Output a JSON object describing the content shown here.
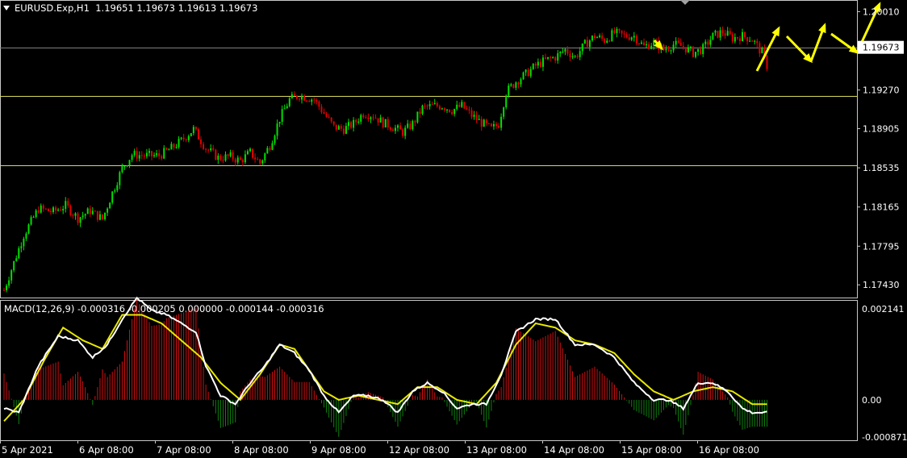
{
  "chart_data": [
    {
      "type": "candlestick",
      "symbol": "EURUSD.Exp,H1",
      "ohlc_header": "1.19651 1.19673 1.19613 1.19673",
      "current_price_label": "1.19673",
      "current_price": 1.19673,
      "ylim": [
        1.1731,
        1.2012
      ],
      "y_ticks": [
        "1.20010",
        "1.19270",
        "1.18905",
        "1.18535",
        "1.18165",
        "1.17795",
        "1.17430"
      ],
      "y_tick_values": [
        1.2001,
        1.1927,
        1.18905,
        1.18535,
        1.18165,
        1.17795,
        1.1743
      ],
      "horizontal_levels": [
        1.19673,
        1.1921,
        1.1856
      ],
      "x_labels": [
        "5 Apr 2021",
        "6 Apr 08:00",
        "7 Apr 08:00",
        "8 Apr 08:00",
        "9 Apr 08:00",
        "12 Apr 08:00",
        "13 Apr 08:00",
        "14 Apr 08:00",
        "15 Apr 08:00",
        "16 Apr 08:00"
      ],
      "bull_color": "#00e000",
      "bear_color": "#e00000",
      "level_color_current": "#808080",
      "level_color_sr": "#d8d860",
      "arrow_color": "#ffff00",
      "close_path": [
        [
          0,
          1.1738
        ],
        [
          8,
          1.179
        ],
        [
          14,
          1.1815
        ],
        [
          20,
          1.1812
        ],
        [
          25,
          1.1818
        ],
        [
          30,
          1.1806
        ],
        [
          35,
          1.1813
        ],
        [
          40,
          1.1805
        ],
        [
          44,
          1.183
        ],
        [
          48,
          1.1853
        ],
        [
          52,
          1.1866
        ],
        [
          58,
          1.1865
        ],
        [
          63,
          1.1865
        ],
        [
          68,
          1.1872
        ],
        [
          72,
          1.1879
        ],
        [
          77,
          1.189
        ],
        [
          82,
          1.1872
        ],
        [
          87,
          1.1863
        ],
        [
          92,
          1.1864
        ],
        [
          96,
          1.186
        ],
        [
          100,
          1.1868
        ],
        [
          104,
          1.1858
        ],
        [
          108,
          1.1875
        ],
        [
          112,
          1.19
        ],
        [
          116,
          1.1918
        ],
        [
          120,
          1.1922
        ],
        [
          126,
          1.1918
        ],
        [
          130,
          1.1905
        ],
        [
          134,
          1.1892
        ],
        [
          138,
          1.189
        ],
        [
          142,
          1.1895
        ],
        [
          146,
          1.1905
        ],
        [
          150,
          1.1903
        ],
        [
          154,
          1.1896
        ],
        [
          158,
          1.1892
        ],
        [
          162,
          1.1887
        ],
        [
          166,
          1.1895
        ],
        [
          170,
          1.191
        ],
        [
          174,
          1.1912
        ],
        [
          178,
          1.1912
        ],
        [
          182,
          1.1908
        ],
        [
          186,
          1.1912
        ],
        [
          190,
          1.1903
        ],
        [
          194,
          1.1896
        ],
        [
          198,
          1.189
        ],
        [
          201,
          1.1895
        ],
        [
          204,
          1.1925
        ],
        [
          208,
          1.1935
        ],
        [
          212,
          1.1942
        ],
        [
          216,
          1.195
        ],
        [
          220,
          1.1955
        ],
        [
          224,
          1.1958
        ],
        [
          228,
          1.1965
        ],
        [
          232,
          1.1958
        ],
        [
          236,
          1.197
        ],
        [
          240,
          1.1978
        ],
        [
          244,
          1.1974
        ],
        [
          248,
          1.1981
        ],
        [
          252,
          1.1978
        ],
        [
          256,
          1.1978
        ],
        [
          260,
          1.1968
        ],
        [
          264,
          1.1972
        ],
        [
          268,
          1.1965
        ],
        [
          272,
          1.197
        ],
        [
          276,
          1.1968
        ],
        [
          280,
          1.1962
        ],
        [
          284,
          1.1966
        ],
        [
          288,
          1.1978
        ],
        [
          292,
          1.1982
        ],
        [
          296,
          1.1976
        ],
        [
          300,
          1.1978
        ],
        [
          304,
          1.1975
        ],
        [
          308,
          1.1962
        ],
        [
          310,
          1.195
        ]
      ],
      "forecast_arrows": [
        [
          [
            938,
            88
          ],
          [
            965,
            35
          ]
        ],
        [
          [
            975,
            45
          ],
          [
            1005,
            76
          ]
        ],
        [
          [
            1005,
            76
          ],
          [
            1022,
            31
          ]
        ],
        [
          [
            1030,
            42
          ],
          [
            1062,
            65
          ]
        ],
        [
          [
            1062,
            65
          ],
          [
            1090,
            5
          ]
        ],
        [
          [
            811,
            50
          ],
          [
            820,
            60
          ]
        ]
      ]
    },
    {
      "type": "macd",
      "header": "MACD(12,26,9) -0.000316 -0.000205 0.000000 -0.000144 -0.000316",
      "ylim": [
        -0.00095,
        0.00235
      ],
      "y_ticks": [
        "0.002141",
        "0.00",
        "-0.000871"
      ],
      "y_tick_values": [
        0.002141,
        0.0,
        -0.000871
      ],
      "main_color": "#ffffff",
      "signal_color": "#e8e800",
      "hist_pos_color": "#d01010",
      "hist_neg_color": "#108010",
      "main_path": [
        [
          0,
          -0.0002
        ],
        [
          6,
          -0.0003
        ],
        [
          14,
          0.0008
        ],
        [
          22,
          0.0015
        ],
        [
          30,
          0.0014
        ],
        [
          36,
          0.001
        ],
        [
          42,
          0.0013
        ],
        [
          48,
          0.0019
        ],
        [
          54,
          0.0024
        ],
        [
          60,
          0.0021
        ],
        [
          66,
          0.002
        ],
        [
          72,
          0.0018
        ],
        [
          78,
          0.0016
        ],
        [
          82,
          0.0008
        ],
        [
          88,
          0.0001
        ],
        [
          94,
          -0.0001
        ],
        [
          100,
          0.0004
        ],
        [
          106,
          0.0008
        ],
        [
          112,
          0.0013
        ],
        [
          118,
          0.0011
        ],
        [
          124,
          0.0007
        ],
        [
          130,
          0.0001
        ],
        [
          136,
          -0.0003
        ],
        [
          142,
          0.0001
        ],
        [
          148,
          0.0001
        ],
        [
          154,
          0.0
        ],
        [
          160,
          -0.0003
        ],
        [
          166,
          0.0002
        ],
        [
          172,
          0.0004
        ],
        [
          178,
          0.0002
        ],
        [
          184,
          -0.0002
        ],
        [
          190,
          -0.0001
        ],
        [
          196,
          -0.0001
        ],
        [
          202,
          0.0006
        ],
        [
          208,
          0.0016
        ],
        [
          216,
          0.0019
        ],
        [
          224,
          0.0019
        ],
        [
          232,
          0.0013
        ],
        [
          240,
          0.0013
        ],
        [
          248,
          0.001
        ],
        [
          256,
          0.0004
        ],
        [
          264,
          0.0
        ],
        [
          270,
          0.0
        ],
        [
          276,
          -0.0002
        ],
        [
          282,
          0.0004
        ],
        [
          288,
          0.0004
        ],
        [
          294,
          0.0002
        ],
        [
          300,
          -0.0002
        ],
        [
          304,
          -0.0003
        ]
      ],
      "signal_path": [
        [
          0,
          -0.0005
        ],
        [
          8,
          0.0
        ],
        [
          16,
          0.0009
        ],
        [
          24,
          0.0017
        ],
        [
          32,
          0.0014
        ],
        [
          40,
          0.0012
        ],
        [
          48,
          0.002
        ],
        [
          56,
          0.002
        ],
        [
          64,
          0.0018
        ],
        [
          72,
          0.0014
        ],
        [
          80,
          0.001
        ],
        [
          88,
          0.0004
        ],
        [
          96,
          0.0
        ],
        [
          104,
          0.0006
        ],
        [
          112,
          0.0013
        ],
        [
          118,
          0.0012
        ],
        [
          124,
          0.0007
        ],
        [
          130,
          0.0002
        ],
        [
          136,
          0.0
        ],
        [
          144,
          0.0001
        ],
        [
          152,
          0.0
        ],
        [
          160,
          -0.0001
        ],
        [
          168,
          0.0003
        ],
        [
          176,
          0.0003
        ],
        [
          184,
          0.0
        ],
        [
          192,
          -0.0001
        ],
        [
          200,
          0.0004
        ],
        [
          208,
          0.0013
        ],
        [
          216,
          0.0018
        ],
        [
          224,
          0.0017
        ],
        [
          232,
          0.0014
        ],
        [
          240,
          0.0013
        ],
        [
          248,
          0.0011
        ],
        [
          256,
          0.0006
        ],
        [
          264,
          0.0002
        ],
        [
          272,
          0.0
        ],
        [
          280,
          0.0002
        ],
        [
          288,
          0.0003
        ],
        [
          296,
          0.0002
        ],
        [
          304,
          -0.0001
        ]
      ]
    }
  ]
}
